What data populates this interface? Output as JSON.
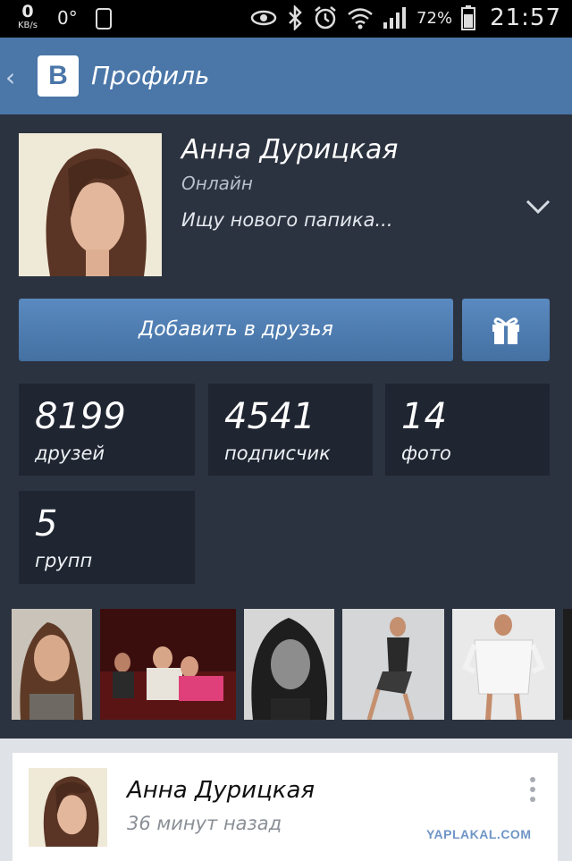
{
  "status_bar": {
    "speed_value": "0",
    "speed_unit": "KB/s",
    "temperature": "0°",
    "battery_percent": "72%",
    "time": "21:57"
  },
  "header": {
    "logo_letter": "B",
    "title": "Профиль"
  },
  "profile": {
    "name": "Анна Дурицкая",
    "status": "Онлайн",
    "mood": "Ищу нового папика..."
  },
  "actions": {
    "add_friend_label": "Добавить в друзья"
  },
  "stats": [
    {
      "value": "8199",
      "label": "друзей"
    },
    {
      "value": "4541",
      "label": "подписчик"
    },
    {
      "value": "14",
      "label": "фото"
    },
    {
      "value": "5",
      "label": "групп"
    }
  ],
  "post": {
    "author": "Анна Дурицкая",
    "time": "36 минут назад"
  },
  "watermark": "YAPLAKAL.COM",
  "colors": {
    "accent": "#4a76a8",
    "background": "#2c3340",
    "tile": "#1f2531"
  }
}
